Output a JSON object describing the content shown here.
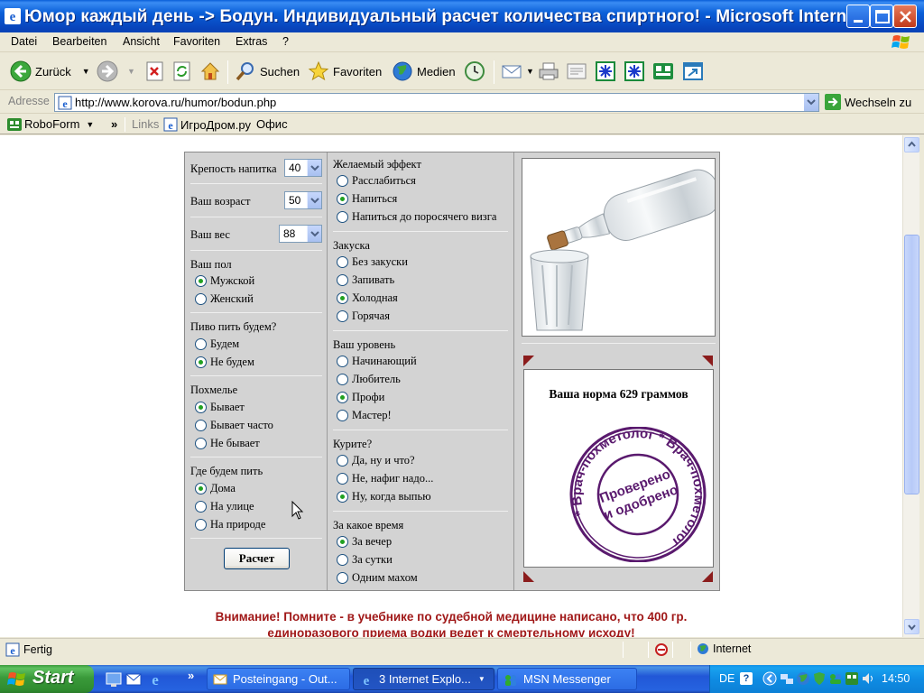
{
  "window": {
    "title": "Юмор каждый день -> Бодун. Индивидуальный расчет количества спиртного! - Microsoft Intern..."
  },
  "menu": [
    "Datei",
    "Bearbeiten",
    "Ansicht",
    "Favoriten",
    "Extras",
    "?"
  ],
  "toolbar": {
    "back": "Zurück",
    "search": "Suchen",
    "favorites": "Favoriten",
    "media": "Medien"
  },
  "address": {
    "label": "Adresse",
    "url": "http://www.korova.ru/humor/bodun.php",
    "go": "Wechseln zu"
  },
  "links": {
    "roboform": "RoboForm",
    "chevron": "»",
    "label": "Links",
    "item1": "ИгроДром.ру",
    "item2": "Офис"
  },
  "form": {
    "strength_label": "Крепость напитка",
    "strength_value": "40",
    "age_label": "Ваш возраст",
    "age_value": "50",
    "weight_label": "Ваш вес",
    "weight_value": "88",
    "sex_label": "Ваш пол",
    "sex_options": [
      "Мужской",
      "Женский"
    ],
    "beer_label": "Пиво пить будем?",
    "beer_options": [
      "Будем",
      "Не будем"
    ],
    "hangover_label": "Похмелье",
    "hangover_options": [
      "Бывает",
      "Бывает часто",
      "Не бывает"
    ],
    "where_label": "Где будем пить",
    "where_options": [
      "Дома",
      "На улице",
      "На природе"
    ],
    "submit": "Расчет",
    "effect_label": "Желаемый эффект",
    "effect_options": [
      "Расслабиться",
      "Напиться",
      "Напиться до поросячего визга"
    ],
    "snack_label": "Закуска",
    "snack_options": [
      "Без закуски",
      "Запивать",
      "Холодная",
      "Горячая"
    ],
    "level_label": "Ваш уровень",
    "level_options": [
      "Начинающий",
      "Любитель",
      "Профи",
      "Мастер!"
    ],
    "smoke_label": "Курите?",
    "smoke_options": [
      "Да, ну и что?",
      "Не, нафиг надо...",
      "Ну, когда выпью"
    ],
    "time_label": "За какое время",
    "time_options": [
      "За вечер",
      "За сутки",
      "Одним махом"
    ]
  },
  "result": {
    "text": "Ваша норма 629 граммов",
    "stamp_outer": "* Врач-похметолог * Врач-похметолог",
    "stamp_inner_1": "Проверено",
    "stamp_inner_2": "и одобрено"
  },
  "warning": {
    "line1": "Внимание! Помните - в учебнике по судебной медицине написано, что 400 гр.",
    "line2": "единоразового приема водки ведет к смертельному исходу!"
  },
  "status": {
    "text": "Fertig",
    "zone": "Internet"
  },
  "taskbar": {
    "start": "Start",
    "chevron": "»",
    "tasks": [
      "Posteingang - Out...",
      "3 Internet Explo...",
      "MSN Messenger"
    ],
    "lang": "DE",
    "clock": "14:50"
  }
}
